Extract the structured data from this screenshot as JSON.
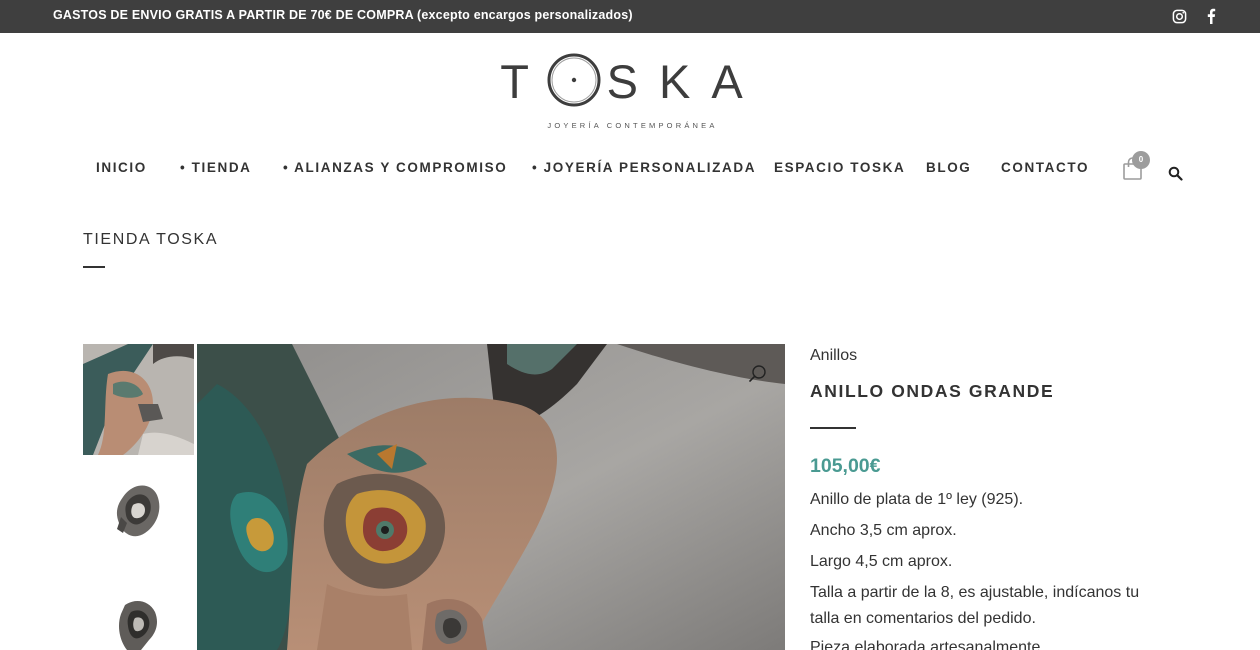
{
  "topbar": {
    "promo": "GASTOS DE ENVIO GRATIS A PARTIR DE 70€ DE COMPRA (excepto encargos personalizados)"
  },
  "brand": {
    "name": "TOSKA",
    "tagline": "JOYERÍA CONTEMPORÁNEA"
  },
  "nav": {
    "items": [
      "INICIO",
      "• TIENDA",
      "• ALIANZAS Y COMPROMISO",
      "• JOYERÍA PERSONALIZADA",
      "ESPACIO TOSKA",
      "BLOG",
      "CONTACTO"
    ],
    "cart_count": "0"
  },
  "page": {
    "title": "TIENDA TOSKA"
  },
  "product": {
    "category": "Anillos",
    "name": "ANILLO ONDAS GRANDE",
    "price": "105,00€",
    "price_color": "#4a9a92",
    "description": [
      "Anillo  de plata de 1º ley (925).",
      "Ancho 3,5 cm aprox.",
      "Largo 4,5 cm aprox.",
      "Talla a partir de la 8, es ajustable, indícanos tu talla en comentarios del pedido.",
      "Pieza elaborada artesanalmente."
    ]
  },
  "icons": [
    "instagram-icon",
    "facebook-icon",
    "cart-icon",
    "search-icon",
    "zoom-icon"
  ]
}
